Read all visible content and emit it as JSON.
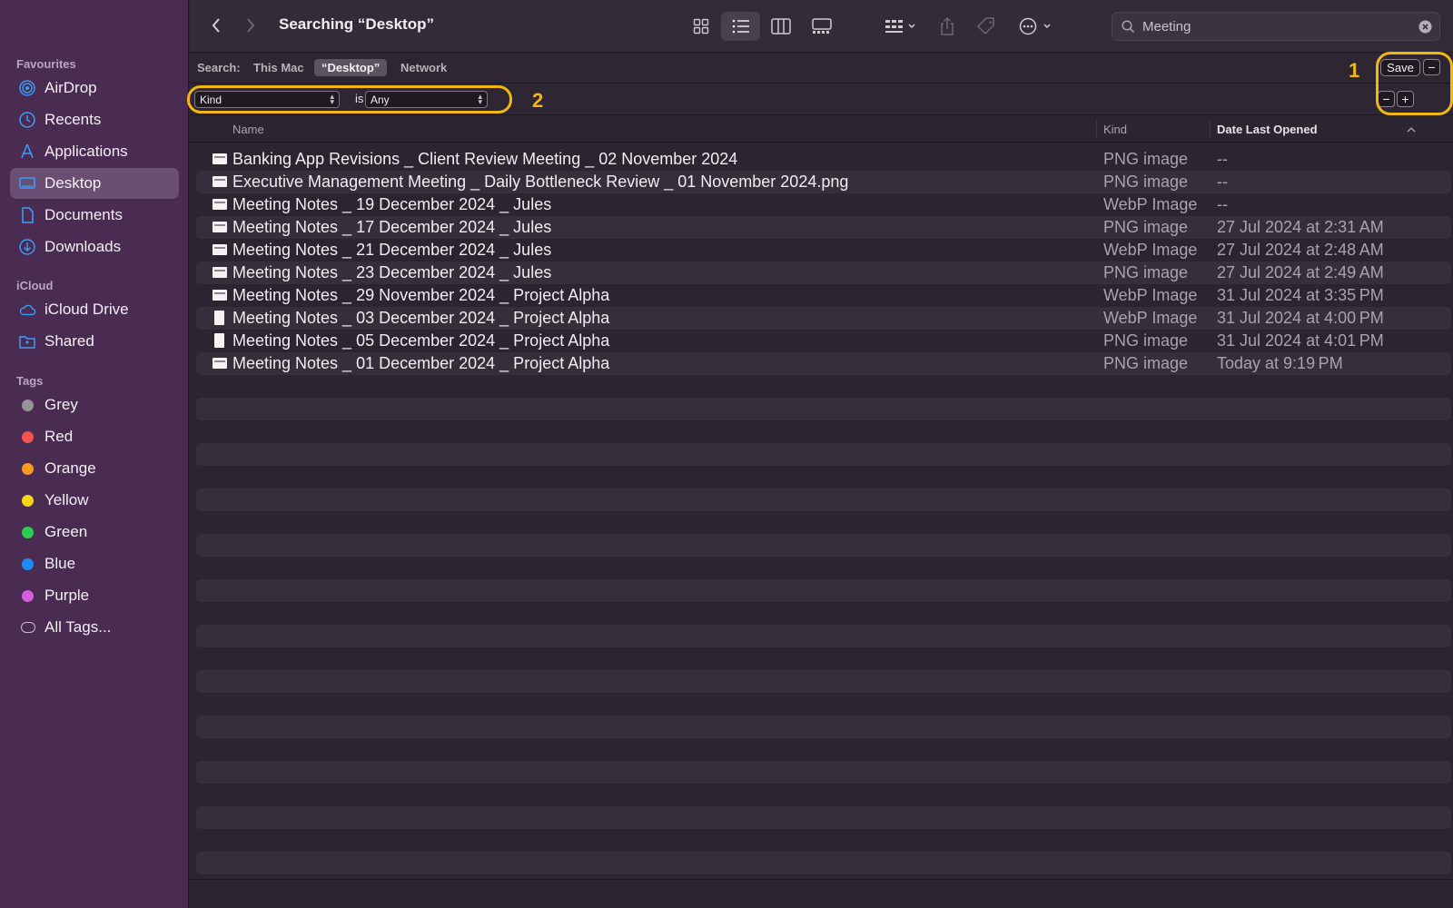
{
  "window": {
    "title": "Searching “Desktop”"
  },
  "sidebar": {
    "favourites_header": "Favourites",
    "favourites": [
      {
        "label": "AirDrop",
        "icon": "airdrop-icon"
      },
      {
        "label": "Recents",
        "icon": "clock-icon"
      },
      {
        "label": "Applications",
        "icon": "applications-icon"
      },
      {
        "label": "Desktop",
        "icon": "desktop-icon",
        "selected": true
      },
      {
        "label": "Documents",
        "icon": "document-icon"
      },
      {
        "label": "Downloads",
        "icon": "download-icon"
      }
    ],
    "icloud_header": "iCloud",
    "icloud": [
      {
        "label": "iCloud Drive",
        "icon": "cloud-icon"
      },
      {
        "label": "Shared",
        "icon": "shared-folder-icon"
      }
    ],
    "tags_header": "Tags",
    "tags": [
      {
        "label": "Grey",
        "color": "#98949b"
      },
      {
        "label": "Red",
        "color": "#f5534f"
      },
      {
        "label": "Orange",
        "color": "#f59a23"
      },
      {
        "label": "Yellow",
        "color": "#f7d619"
      },
      {
        "label": "Green",
        "color": "#30cb52"
      },
      {
        "label": "Blue",
        "color": "#1e8af5"
      },
      {
        "label": "Purple",
        "color": "#d55ee3"
      },
      {
        "label": "All Tags...",
        "icon": "all-tags-icon"
      }
    ]
  },
  "toolbar": {
    "icons": [
      "back-icon",
      "forward-icon",
      "icon-view-icon",
      "list-view-icon",
      "column-view-icon",
      "gallery-view-icon",
      "group-icon",
      "share-icon",
      "tag-icon",
      "more-icon"
    ],
    "search_value": "Meeting",
    "search_placeholder": "Search"
  },
  "scope": {
    "label": "Search:",
    "options": [
      "This Mac",
      "“Desktop”",
      "Network"
    ],
    "active": "“Desktop”",
    "save_label": "Save",
    "minus_label": "−",
    "plus_label": "+"
  },
  "rule": {
    "attribute": "Kind",
    "operator": "is",
    "value": "Any"
  },
  "annotations": [
    {
      "number": "1",
      "color": "#f2b713"
    },
    {
      "number": "2",
      "color": "#f2b713"
    }
  ],
  "columns": {
    "name": "Name",
    "kind": "Kind",
    "date": "Date Last Opened"
  },
  "files": [
    {
      "name": "Banking App Revisions _ Client Review Meeting _ 02 November 2024",
      "kind": "PNG image",
      "date": "--",
      "icon": "image"
    },
    {
      "name": "Executive Management Meeting _ Daily Bottleneck Review _ 01 November 2024.png",
      "kind": "PNG image",
      "date": "--",
      "icon": "image"
    },
    {
      "name": "Meeting Notes _ 19 December 2024 _ Jules",
      "kind": "WebP Image",
      "date": "--",
      "icon": "image"
    },
    {
      "name": "Meeting Notes _ 17 December 2024 _ Jules",
      "kind": "PNG image",
      "date": "27 Jul 2024 at 2:31 AM",
      "icon": "image"
    },
    {
      "name": "Meeting Notes _ 21 December 2024 _ Jules",
      "kind": "WebP Image",
      "date": "27 Jul 2024 at 2:48 AM",
      "icon": "image"
    },
    {
      "name": "Meeting Notes _ 23 December 2024 _ Jules",
      "kind": "PNG image",
      "date": "27 Jul 2024 at 2:49 AM",
      "icon": "image"
    },
    {
      "name": "Meeting Notes _ 29 November 2024 _ Project Alpha",
      "kind": "WebP Image",
      "date": "31 Jul 2024 at 3:35 PM",
      "icon": "image"
    },
    {
      "name": "Meeting Notes _ 03 December 2024 _ Project Alpha",
      "kind": "WebP Image",
      "date": "31 Jul 2024 at 4:00 PM",
      "icon": "doc"
    },
    {
      "name": "Meeting Notes _ 05 December 2024 _ Project Alpha",
      "kind": "PNG image",
      "date": "31 Jul 2024 at 4:01 PM",
      "icon": "doc"
    },
    {
      "name": "Meeting Notes _ 01 December 2024 _ Project Alpha",
      "kind": "PNG image",
      "date": "Today at 9:19 PM",
      "icon": "image"
    }
  ]
}
